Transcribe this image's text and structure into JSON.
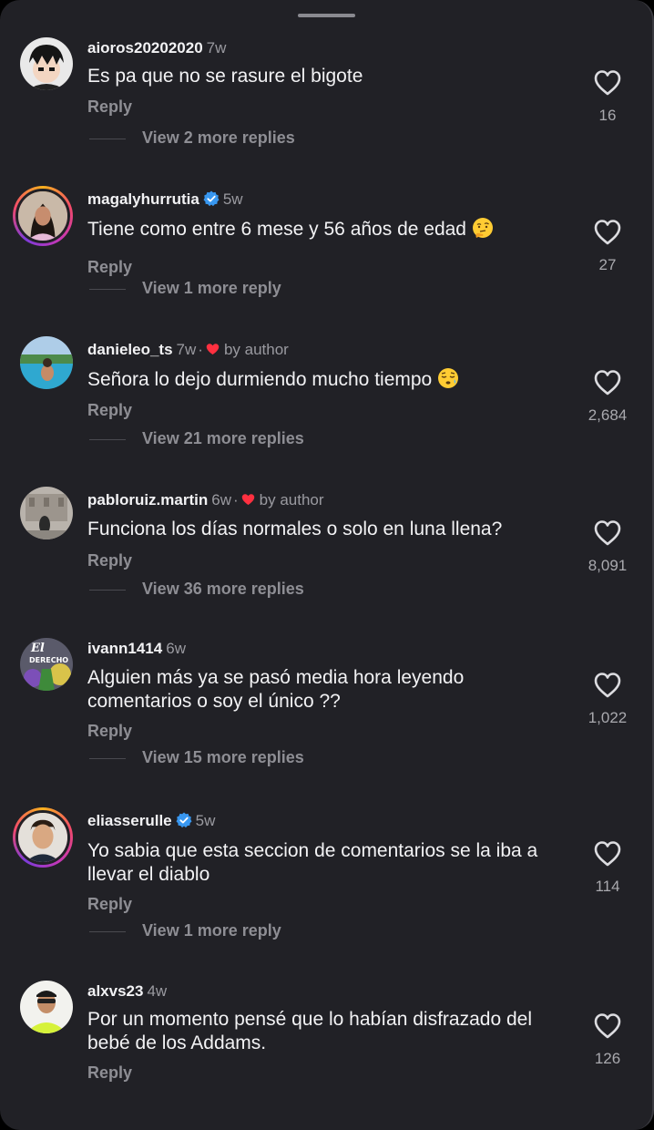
{
  "comments": [
    {
      "username": "aioros20202020",
      "time": "7w",
      "text": "Es pa que no se rasure el bigote",
      "reply_label": "Reply",
      "view_replies": "View 2 more replies",
      "likes": "16"
    },
    {
      "username": "magalyhurrutia",
      "time": "5w",
      "verified": true,
      "text": "Tiene como entre 6 mese y 56 años de edad",
      "emoji": "thinking-face",
      "reply_label": "Reply",
      "view_replies": "View 1 more reply",
      "likes": "27"
    },
    {
      "username": "danieleo_ts",
      "time": "7w",
      "liked_by_author": "by author",
      "text": "Señora lo dejo durmiendo mucho tiempo",
      "emoji": "sleepy-face",
      "reply_label": "Reply",
      "view_replies": "View 21 more replies",
      "likes": "2,684"
    },
    {
      "username": "pabloruiz.martin",
      "time": "6w",
      "liked_by_author": "by author",
      "text": "Funciona los días normales o solo en luna llena?",
      "reply_label": "Reply",
      "view_replies": "View 36 more replies",
      "likes": "8,091"
    },
    {
      "username": "ivann1414",
      "time": "6w",
      "text": "Alguien más ya se pasó media hora leyendo comentarios o soy el único ??",
      "reply_label": "Reply",
      "view_replies": "View 15 more replies",
      "likes": "1,022"
    },
    {
      "username": "eliasserulle",
      "time": "5w",
      "verified": true,
      "text": "Yo sabia que esta seccion de comentarios se la iba a llevar el diablo",
      "reply_label": "Reply",
      "view_replies": "View 1 more reply",
      "likes": "114"
    },
    {
      "username": "alxvs23",
      "time": "4w",
      "text": "Por un momento pensé que lo habían disfrazado del bebé de los Addams.",
      "reply_label": "Reply",
      "likes": "126"
    }
  ],
  "avatar_art": {
    "ivann1414_overlay_a": "El",
    "ivann1414_overlay_b": "DERECHO"
  },
  "colors": {
    "background": "#212126",
    "verified_badge": "#3897f0",
    "author_heart": "#ff3040",
    "text_primary": "#f2f2f4",
    "text_secondary": "#8e8e94"
  },
  "icons": {
    "like": "heart-outline-icon",
    "verified": "verified-badge-icon",
    "author_like": "heart-filled-icon"
  }
}
